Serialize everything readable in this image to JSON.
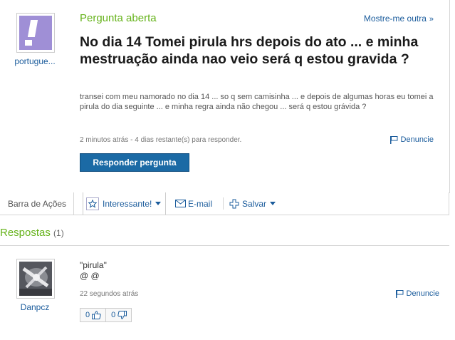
{
  "question": {
    "status": "Pergunta aberta",
    "more_link": "Mostre-me outra",
    "more_arrow": "»",
    "user": "portugue...",
    "title": "No dia 14 Tomei pirula hrs depois do ato ... e minha mestruação ainda nao veio será q estou gravida ?",
    "body": "transei com meu namorado no dia 14 ... so q sem camisinha ... e depois de algumas horas eu tomei a pirula do dia seguinte ... e minha regra ainda não chegou ... será q estou grávida ?",
    "meta": "2 minutos atrás - 4 dias restante(s) para responder.",
    "report": "Denuncie",
    "reply_button": "Responder pergunta"
  },
  "actions": {
    "label": "Barra de Ações",
    "interesting": "Interessante!",
    "email": "E-mail",
    "save": "Salvar"
  },
  "answers": {
    "heading": "Respostas",
    "count": "(1)",
    "items": [
      {
        "user": "Danpcz",
        "text_line1": "\"pirula\"",
        "text_line2": "@ @",
        "meta": "22 segundos atrás",
        "report": "Denuncie",
        "thumbs_up": "0",
        "thumbs_down": "0"
      }
    ]
  },
  "colors": {
    "green": "#66b31b",
    "link": "#1b5c9c",
    "button": "#1b6aa5",
    "avatar_bg": "#9f8fd6"
  }
}
